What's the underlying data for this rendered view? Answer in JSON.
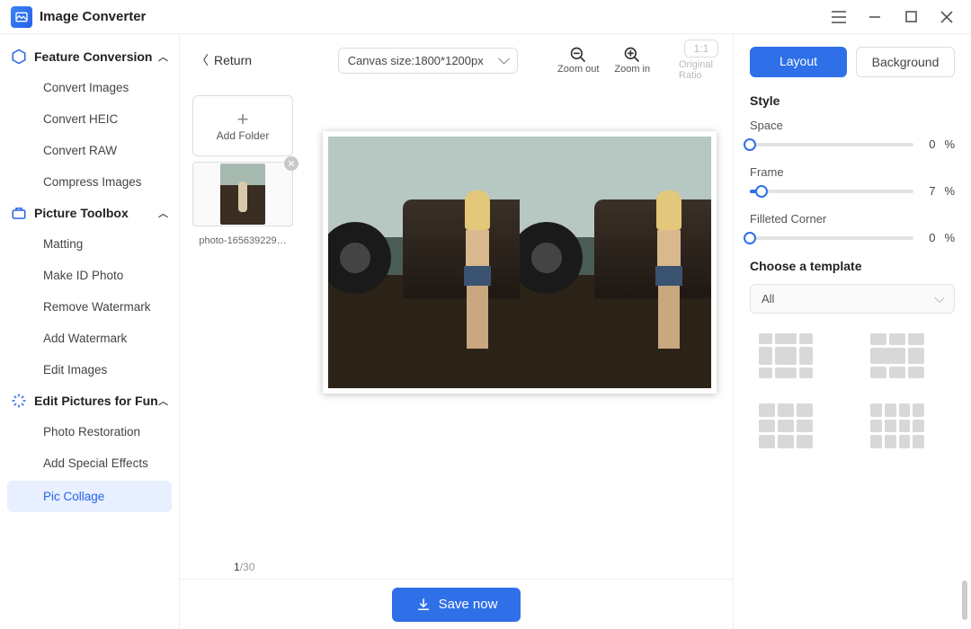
{
  "app": {
    "title": "Image Converter"
  },
  "window_controls": {
    "menu": "≡",
    "minimize": "—",
    "maximize": "▢",
    "close": "✕"
  },
  "sidebar": {
    "sections": [
      {
        "title": "Feature Conversion",
        "expanded": true,
        "items": [
          "Convert Images",
          "Convert HEIC",
          "Convert RAW",
          "Compress Images"
        ]
      },
      {
        "title": "Picture Toolbox",
        "expanded": true,
        "items": [
          "Matting",
          "Make ID Photo",
          "Remove Watermark",
          "Add Watermark",
          "Edit Images"
        ]
      },
      {
        "title": "Edit Pictures for Fun",
        "expanded": true,
        "items": [
          "Photo Restoration",
          "Add Special Effects",
          "Pic Collage"
        ]
      }
    ],
    "active": "Pic Collage"
  },
  "toolbar": {
    "return": "Return",
    "canvas_size_label": "Canvas size:",
    "canvas_size_value": "1800*1200px",
    "zoom_out": "Zoom out",
    "zoom_in": "Zoom in",
    "ratio_btn": "1:1",
    "original_ratio": "Original Ratio"
  },
  "thumbs": {
    "add_folder": "Add Folder",
    "items": [
      {
        "name": "photo-165639229…"
      }
    ],
    "counter_current": "1",
    "counter_total": "/30"
  },
  "save": {
    "label": "Save now"
  },
  "right": {
    "tabs": {
      "layout": "Layout",
      "background": "Background",
      "active": "layout"
    },
    "style_title": "Style",
    "sliders": {
      "space": {
        "label": "Space",
        "value": "0",
        "unit": "%",
        "pct": 0
      },
      "frame": {
        "label": "Frame",
        "value": "7",
        "unit": "%",
        "pct": 7
      },
      "corner": {
        "label": "Filleted Corner",
        "value": "0",
        "unit": "%",
        "pct": 0
      }
    },
    "template_title": "Choose a template",
    "template_filter": "All"
  }
}
